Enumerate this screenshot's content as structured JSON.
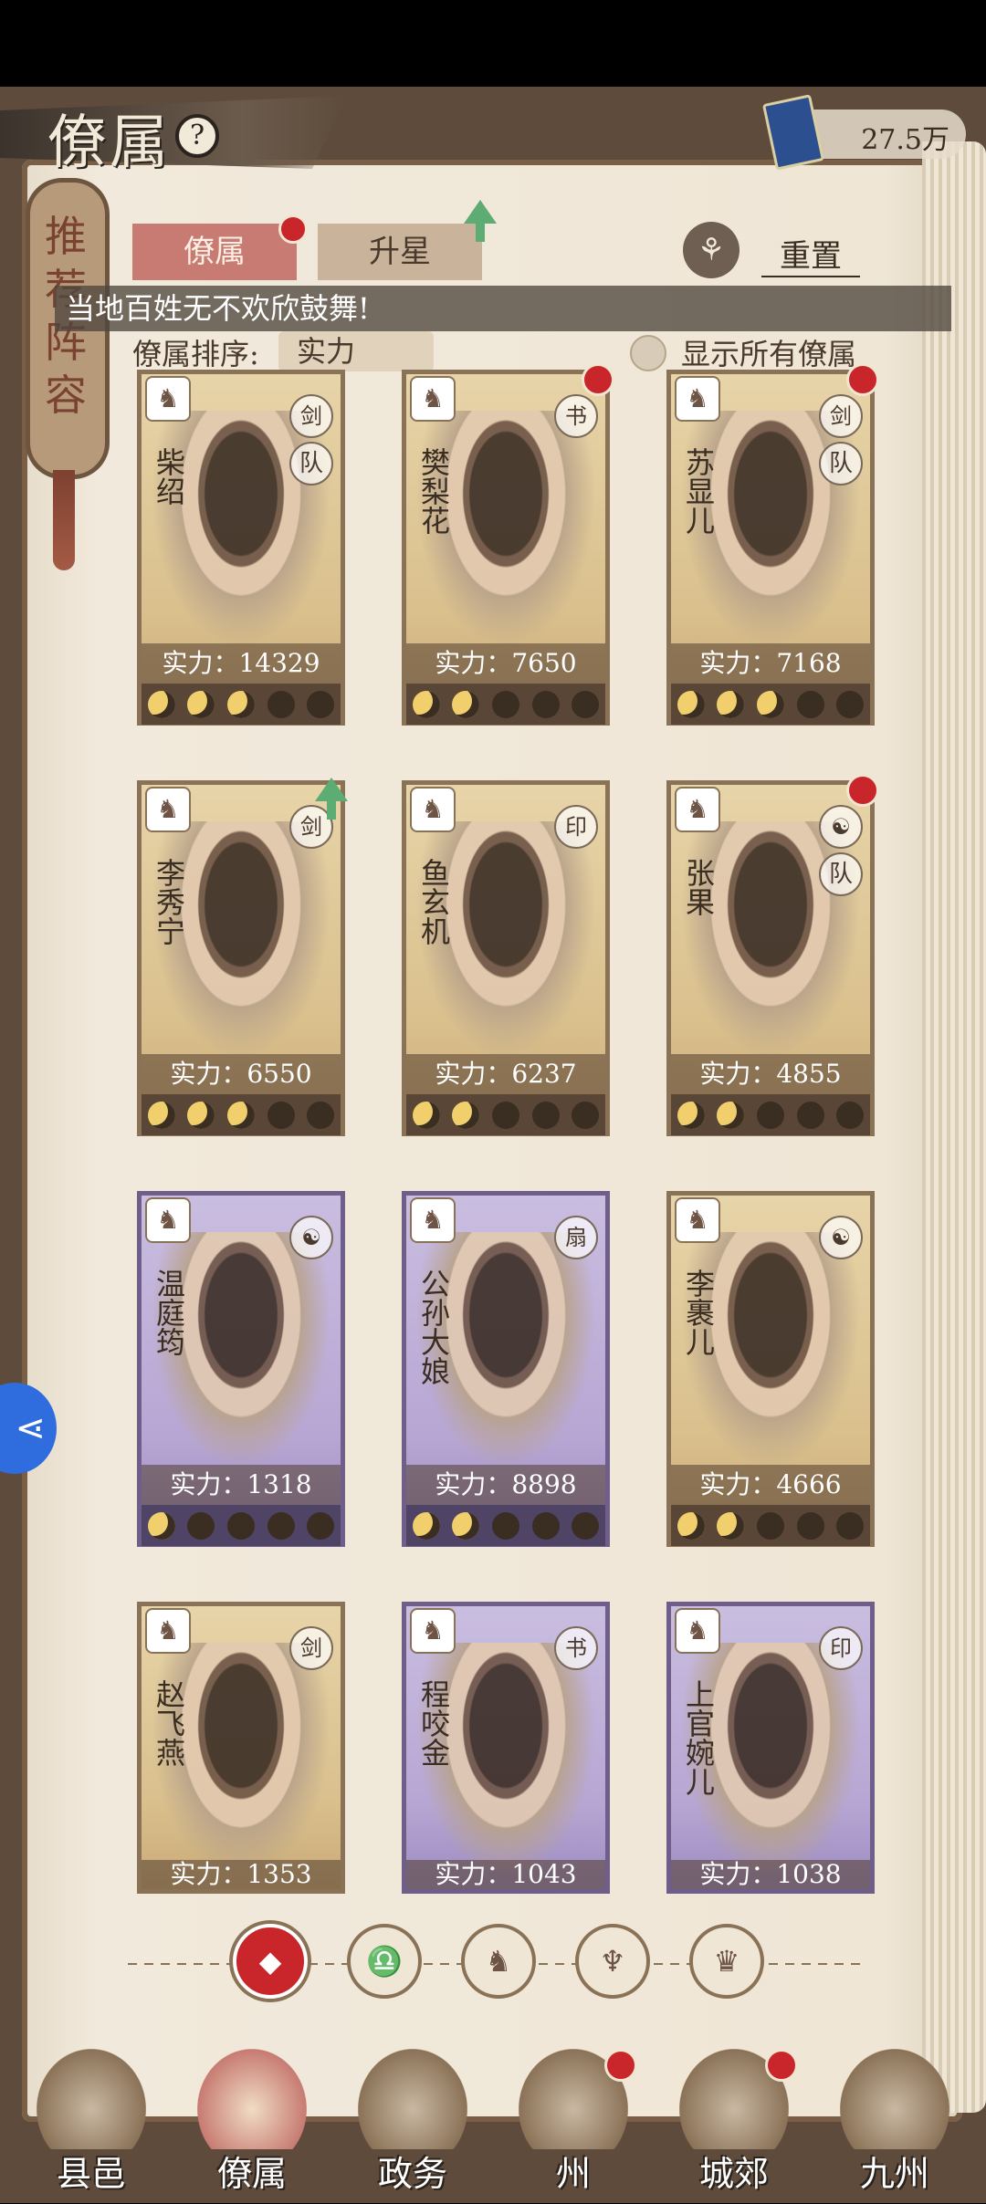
{
  "header": {
    "title": "僚属",
    "currency_value": "27.5万"
  },
  "recommend": {
    "label": "推荐阵容"
  },
  "tabs": [
    {
      "label": "僚属"
    },
    {
      "label": "升星"
    }
  ],
  "reset": {
    "label": "重置"
  },
  "toast": "当地百姓无不欢欣鼓舞!",
  "sort": {
    "label": "僚属排序:",
    "value": "实力"
  },
  "show_all": {
    "label": "显示所有僚属"
  },
  "cards": [
    {
      "name": "柴绍",
      "power": "实力：14329",
      "stars": 3,
      "theme": "gold",
      "team": "队",
      "badge": "剑",
      "red_dot": false,
      "up": false
    },
    {
      "name": "樊梨花",
      "power": "实力：7650",
      "stars": 2,
      "theme": "gold",
      "team": "",
      "badge": "书",
      "red_dot": true,
      "up": false
    },
    {
      "name": "苏显儿",
      "power": "实力：7168",
      "stars": 3,
      "theme": "gold",
      "team": "队",
      "badge": "剑",
      "red_dot": true,
      "up": false
    },
    {
      "name": "李秀宁",
      "power": "实力：6550",
      "stars": 3,
      "theme": "gold",
      "team": "",
      "badge": "剑",
      "red_dot": false,
      "up": true
    },
    {
      "name": "鱼玄机",
      "power": "实力：6237",
      "stars": 2,
      "theme": "gold",
      "team": "",
      "badge": "印",
      "red_dot": false,
      "up": false
    },
    {
      "name": "张果",
      "power": "实力：4855",
      "stars": 2,
      "theme": "gold",
      "team": "队",
      "badge": "☯",
      "red_dot": true,
      "up": false
    },
    {
      "name": "温庭筠",
      "power": "实力：1318",
      "stars": 1,
      "theme": "purple",
      "team": "",
      "badge": "☯",
      "red_dot": false,
      "up": false
    },
    {
      "name": "公孙大娘",
      "power": "实力：8898",
      "stars": 2,
      "theme": "purple",
      "team": "",
      "badge": "扇",
      "red_dot": false,
      "up": false
    },
    {
      "name": "李裹儿",
      "power": "实力：4666",
      "stars": 2,
      "theme": "gold",
      "team": "",
      "badge": "☯",
      "red_dot": false,
      "up": false
    },
    {
      "name": "赵飞燕",
      "power": "实力：1353",
      "stars": 0,
      "theme": "gold",
      "team": "",
      "badge": "剑",
      "red_dot": false,
      "up": false
    },
    {
      "name": "程咬金",
      "power": "实力：1043",
      "stars": 0,
      "theme": "purple",
      "team": "",
      "badge": "书",
      "red_dot": false,
      "up": false
    },
    {
      "name": "上官婉儿",
      "power": "实力：1038",
      "stars": 0,
      "theme": "purple",
      "team": "",
      "badge": "印",
      "red_dot": false,
      "up": false
    }
  ],
  "filters": [
    {
      "icon": "all-icon",
      "glyph": "◆"
    },
    {
      "icon": "bell-icon",
      "glyph": "♎"
    },
    {
      "icon": "horse-icon",
      "glyph": "♞"
    },
    {
      "icon": "fan-icon",
      "glyph": "♆"
    },
    {
      "icon": "lion-icon",
      "glyph": "♛"
    }
  ],
  "nav": [
    {
      "label": "县邑",
      "dot": false
    },
    {
      "label": "僚属",
      "dot": false
    },
    {
      "label": "政务",
      "dot": false
    },
    {
      "label": "州",
      "dot": true
    },
    {
      "label": "城郊",
      "dot": true
    },
    {
      "label": "九州",
      "dot": false
    }
  ],
  "colors": {
    "active_tab": "#c77b72",
    "red_dot": "#c8262a",
    "star_on": "#f1cf6c"
  }
}
